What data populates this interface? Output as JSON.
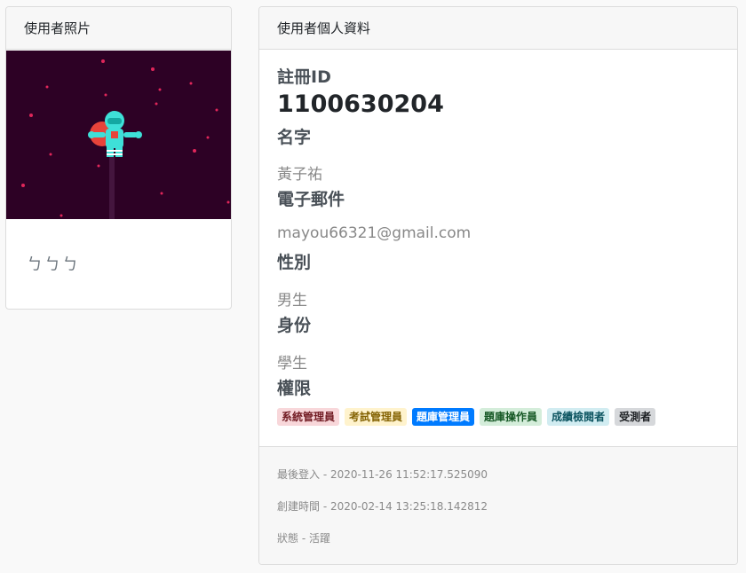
{
  "photo_card": {
    "title": "使用者照片",
    "caption": "ㄅㄅㄅ"
  },
  "profile_card": {
    "title": "使用者個人資料",
    "fields": {
      "reg_id_label": "註冊ID",
      "reg_id_value": "1100630204",
      "name_label": "名字",
      "name_value": "黃子祐",
      "email_label": "電子郵件",
      "email_value": "mayou66321@gmail.com",
      "gender_label": "性別",
      "gender_value": "男生",
      "identity_label": "身份",
      "identity_value": "學生",
      "permission_label": "權限"
    },
    "roles": [
      {
        "label": "系統管理員",
        "bg": "#f8d7da",
        "fg": "#721c24"
      },
      {
        "label": "考試管理員",
        "bg": "#fff3cd",
        "fg": "#856404"
      },
      {
        "label": "題庫管理員",
        "bg": "#007bff",
        "fg": "#ffffff"
      },
      {
        "label": "題庫操作員",
        "bg": "#d4edda",
        "fg": "#155724"
      },
      {
        "label": "成績檢閱者",
        "bg": "#d1ecf1",
        "fg": "#0c5460"
      },
      {
        "label": "受測者",
        "bg": "#d6d8db",
        "fg": "#1b1e21"
      }
    ],
    "footer": {
      "last_login": "最後登入 - 2020-11-26 11:52:17.525090",
      "created": "創建時間 - 2020-02-14 13:25:18.142812",
      "status": "狀態 - 活躍"
    }
  },
  "colors": {
    "photo_background": "#2d0125",
    "astronaut": "#3ee0d8",
    "planet": "#e8433a",
    "star": "#e0265a"
  }
}
